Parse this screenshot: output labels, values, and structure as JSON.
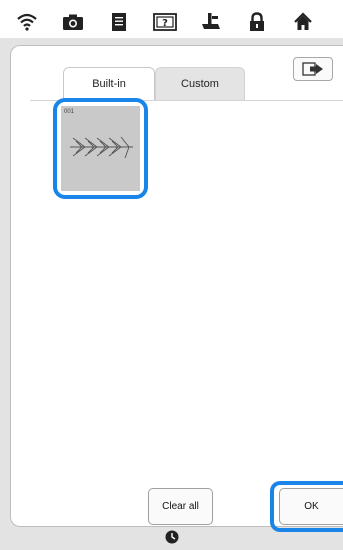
{
  "top_bar": {
    "icons": [
      "wifi-icon",
      "camera-icon",
      "document-icon",
      "help-icon",
      "presser-foot-icon",
      "lock-icon",
      "home-icon"
    ]
  },
  "tabs": {
    "builtin_label": "Built-in",
    "custom_label": "Custom",
    "active": "Built-in"
  },
  "exit_button": {
    "icon": "exit-icon"
  },
  "patterns": [
    {
      "number": "001",
      "selected": true
    }
  ],
  "buttons": {
    "clear_all": "Clear all",
    "ok": "OK"
  },
  "bottom": {
    "icon": "clock-icon"
  },
  "colors": {
    "highlight": "#1a85e8",
    "pattern_background": "#c9c9c9",
    "inactive_tab": "#e4e4e4"
  }
}
